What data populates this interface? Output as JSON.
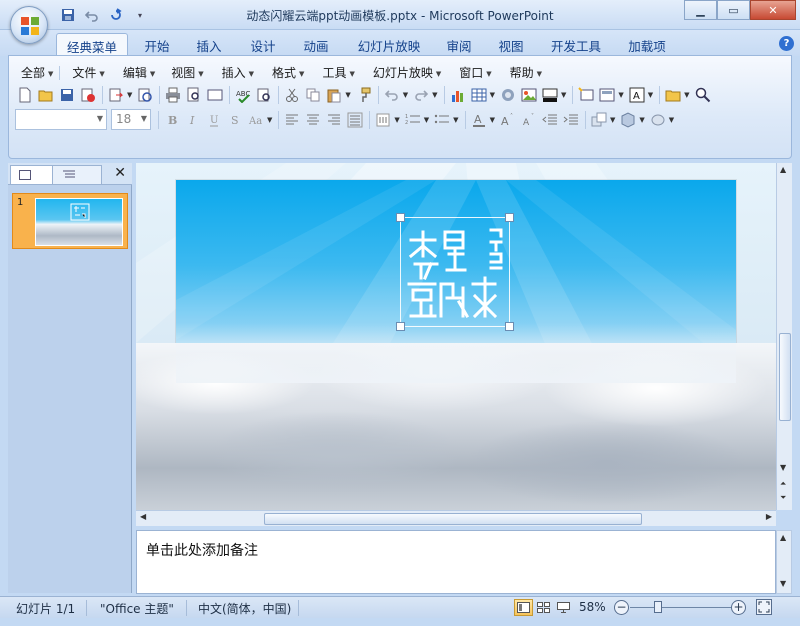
{
  "window": {
    "title": "动态闪耀云端ppt动画模板.pptx - Microsoft PowerPoint"
  },
  "ribbon_tabs": [
    "经典菜单",
    "开始",
    "插入",
    "设计",
    "动画",
    "幻灯片放映",
    "审阅",
    "视图",
    "开发工具",
    "加载项"
  ],
  "active_tab": "经典菜单",
  "classic_menu": [
    "全部",
    "文件",
    "编辑",
    "视图",
    "插入",
    "格式",
    "工具",
    "幻灯片放映",
    "窗口",
    "帮助"
  ],
  "format_bar": {
    "font_name": "",
    "font_size": "18"
  },
  "slide_panel": {
    "slide_number": "1"
  },
  "notes": {
    "placeholder": "单击此处添加备注"
  },
  "status_bar": {
    "slide_info": "幻灯片 1/1",
    "theme": "\"Office 主题\"",
    "language": "中文(简体，中国)",
    "zoom": "58%"
  },
  "colors": {
    "slide_sky_top": "#0aa8ec",
    "selection_thumb": "#f9b24c",
    "ribbon_bg": "#dde9f8"
  }
}
